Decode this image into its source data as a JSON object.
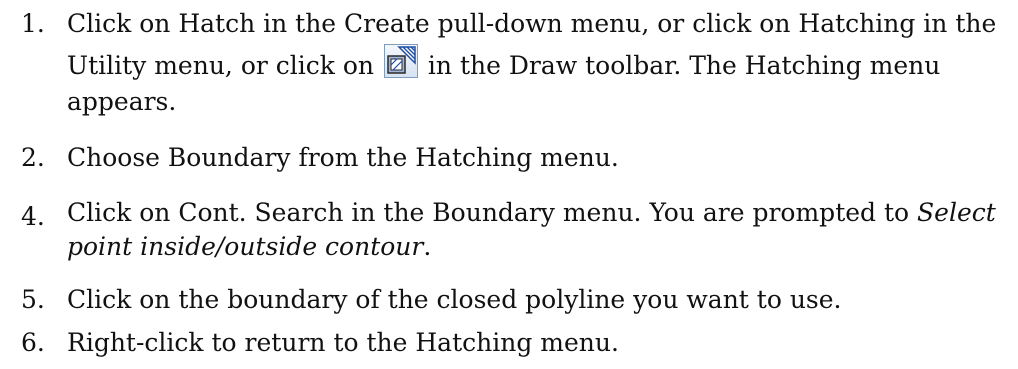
{
  "steps": [
    {
      "number": "1.",
      "lines": {
        "l1": "Click on Hatch in the Create pull-down menu, or click on Hatching in the",
        "l2_before": "Utility menu, or click on",
        "l2_after": "in the Draw toolbar. The Hatching menu",
        "l3": "appears."
      },
      "icon": "hatch-icon"
    },
    {
      "number": "2.",
      "text": "Choose Boundary from the Hatching menu."
    },
    {
      "number": "4.",
      "lines": {
        "l1_before": "Click on Cont. Search in the Boundary menu. You are prompted to",
        "l1_italic": "Select",
        "l2_italic": "point inside/outside contour",
        "l2_after": "."
      }
    },
    {
      "number": "5.",
      "text": "Click on the boundary of the closed polyline you want to use."
    },
    {
      "number": "6.",
      "text": "Right-click to return to the Hatching menu."
    }
  ],
  "colors": {
    "text": "#111111",
    "icon_border": "#7f9db9",
    "icon_hatch": "#1f4fa3",
    "icon_box": "#2a2a2a"
  }
}
